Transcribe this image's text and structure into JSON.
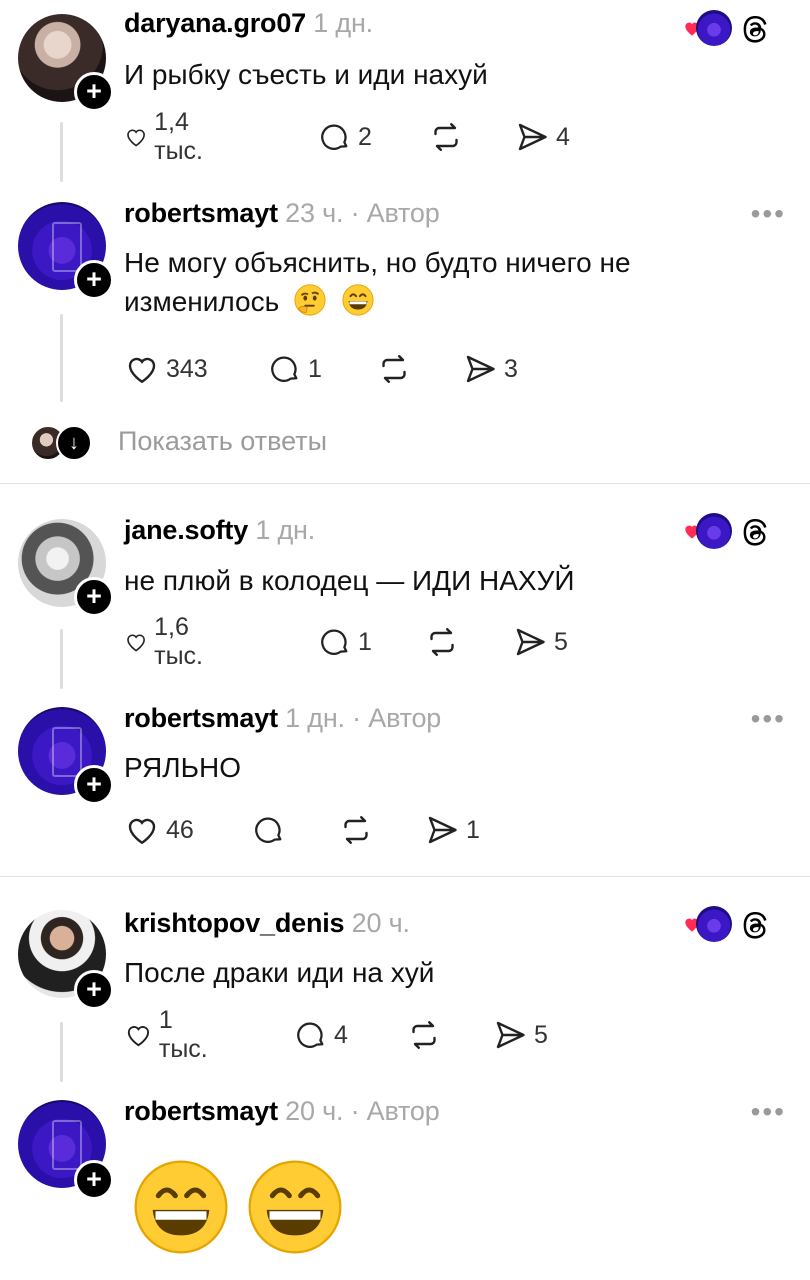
{
  "posts": [
    {
      "username": "daryana.gro07",
      "time": "1 дн.",
      "text": "И рыбку съесть и иди нахуй",
      "likes": "1,4 тыс.",
      "replies": "2",
      "reposts": "",
      "shares": "4"
    },
    {
      "username": "robertsmayt",
      "time": "23 ч.",
      "author_tag": "· Автор",
      "text": "Не могу объяснить, но будто ничего не изменилось",
      "emojis": [
        "thinking-face",
        "grinning-face"
      ],
      "likes": "343",
      "replies": "1",
      "reposts": "",
      "shares": "3"
    },
    {
      "username": "jane.softy",
      "time": "1 дн.",
      "text": "не плюй в колодец — ИДИ НАХУЙ",
      "likes": "1,6 тыс.",
      "replies": "1",
      "reposts": "",
      "shares": "5"
    },
    {
      "username": "robertsmayt",
      "time": "1 дн.",
      "author_tag": "· Автор",
      "text": "РЯЛЬНО",
      "likes": "46",
      "replies": "",
      "reposts": "",
      "shares": "1"
    },
    {
      "username": "krishtopov_denis",
      "time": "20 ч.",
      "text": "После драки иди на хуй",
      "likes": "1 тыс.",
      "replies": "4",
      "reposts": "",
      "shares": "5"
    },
    {
      "username": "robertsmayt",
      "time": "20 ч.",
      "author_tag": "· Автор",
      "emojis": [
        "grinning-face",
        "grinning-face"
      ]
    }
  ],
  "show_replies": {
    "label": "Показать ответы"
  },
  "more_label": "•••",
  "colors": {
    "heart": "#ff2d55",
    "accent_avatar": "#3b18c4",
    "meta_gray": "#a8a8a8",
    "divider": "#e2e2e2"
  },
  "icons": [
    "heart-icon",
    "comment-icon",
    "repost-icon",
    "share-icon",
    "threads-logo-icon",
    "more-icon",
    "follow-plus-icon",
    "arrow-down-icon"
  ]
}
